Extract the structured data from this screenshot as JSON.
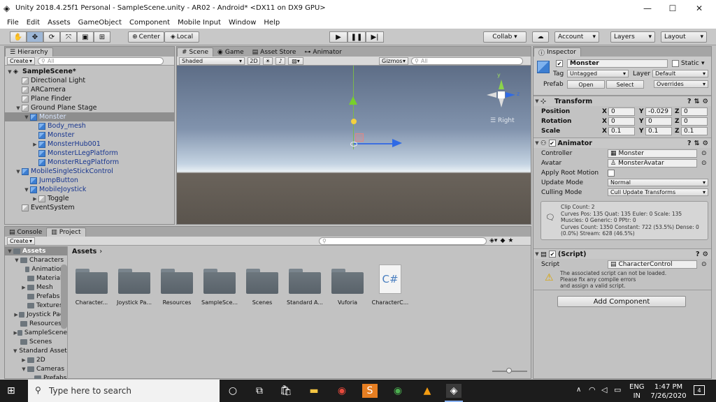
{
  "window": {
    "title": "Unity 2018.4.25f1 Personal - SampleScene.unity - AR02 - Android* <DX11 on DX9 GPU>",
    "minimize": "—",
    "maximize": "☐",
    "close": "✕"
  },
  "menu": [
    "File",
    "Edit",
    "Assets",
    "GameObject",
    "Component",
    "Mobile Input",
    "Window",
    "Help"
  ],
  "toolbar": {
    "center": "Center",
    "local": "Local",
    "collab": "Collab ▾",
    "account": "Account",
    "layers": "Layers",
    "layout": "Layout"
  },
  "hierarchy": {
    "tab": "Hierarchy",
    "create": "Create",
    "search_placeholder": "All",
    "rows": [
      {
        "label": "SampleScene*",
        "indent": 0,
        "icon": "unity",
        "arrow": "▼",
        "bold": true
      },
      {
        "label": "Directional Light",
        "indent": 1,
        "icon": "g",
        "arrow": ""
      },
      {
        "label": "ARCamera",
        "indent": 1,
        "icon": "g",
        "arrow": ""
      },
      {
        "label": "Plane Finder",
        "indent": 1,
        "icon": "g",
        "arrow": ""
      },
      {
        "label": "Ground Plane Stage",
        "indent": 1,
        "icon": "g",
        "arrow": "▼"
      },
      {
        "label": "Monster",
        "indent": 2,
        "icon": "b",
        "arrow": "▼",
        "selected": true,
        "blue": true
      },
      {
        "label": "Body_mesh",
        "indent": 3,
        "icon": "b",
        "arrow": "",
        "blue": true
      },
      {
        "label": "Monster",
        "indent": 3,
        "icon": "b",
        "arrow": "",
        "blue": true
      },
      {
        "label": "MonsterHub001",
        "indent": 3,
        "icon": "b",
        "arrow": "▶",
        "blue": true
      },
      {
        "label": "MonsterLLegPlatform",
        "indent": 3,
        "icon": "b",
        "arrow": "",
        "blue": true
      },
      {
        "label": "MonsterRLegPlatform",
        "indent": 3,
        "icon": "b",
        "arrow": "",
        "blue": true
      },
      {
        "label": "MobileSingleStickControl",
        "indent": 1,
        "icon": "b",
        "arrow": "▼",
        "blue": true
      },
      {
        "label": "JumpButton",
        "indent": 2,
        "icon": "b",
        "arrow": "",
        "blue": true
      },
      {
        "label": "MobileJoystick",
        "indent": 2,
        "icon": "b",
        "arrow": "▼",
        "blue": true
      },
      {
        "label": "Toggle",
        "indent": 3,
        "icon": "g",
        "arrow": "▶"
      },
      {
        "label": "EventSystem",
        "indent": 1,
        "icon": "g",
        "arrow": ""
      }
    ]
  },
  "scene": {
    "tabs": [
      "Scene",
      "Game",
      "Asset Store",
      "Animator"
    ],
    "shaded": "Shaded",
    "mode_2d": "2D",
    "gizmos": "Gizmos",
    "search_placeholder": "All",
    "view_label": "Right",
    "axis_y": "y",
    "axis_z": "z"
  },
  "project": {
    "tabs": [
      "Console",
      "Project"
    ],
    "create": "Create",
    "breadcrumb": "Assets",
    "tree": [
      {
        "label": "Assets",
        "indent": 0,
        "arrow": "▼",
        "selected": true,
        "bold": true
      },
      {
        "label": "Characters",
        "indent": 1,
        "arrow": "▼"
      },
      {
        "label": "Animations",
        "indent": 2,
        "arrow": ""
      },
      {
        "label": "Materials",
        "indent": 2,
        "arrow": ""
      },
      {
        "label": "Mesh",
        "indent": 2,
        "arrow": "▶"
      },
      {
        "label": "Prefabs",
        "indent": 2,
        "arrow": ""
      },
      {
        "label": "Textures",
        "indent": 2,
        "arrow": ""
      },
      {
        "label": "Joystick Pack",
        "indent": 1,
        "arrow": "▶"
      },
      {
        "label": "Resources",
        "indent": 1,
        "arrow": ""
      },
      {
        "label": "SampleScene",
        "indent": 1,
        "arrow": "▶"
      },
      {
        "label": "Scenes",
        "indent": 1,
        "arrow": ""
      },
      {
        "label": "Standard Assets",
        "indent": 1,
        "arrow": "▼"
      },
      {
        "label": "2D",
        "indent": 2,
        "arrow": "▶"
      },
      {
        "label": "Cameras",
        "indent": 2,
        "arrow": "▼"
      },
      {
        "label": "Prefabs",
        "indent": 3,
        "arrow": ""
      }
    ],
    "items": [
      {
        "label": "Character...",
        "type": "folder"
      },
      {
        "label": "Joystick Pa...",
        "type": "folder"
      },
      {
        "label": "Resources",
        "type": "folder"
      },
      {
        "label": "SampleSce...",
        "type": "folder"
      },
      {
        "label": "Scenes",
        "type": "folder"
      },
      {
        "label": "Standard A...",
        "type": "folder"
      },
      {
        "label": "Vuforia",
        "type": "folder"
      },
      {
        "label": "CharacterC...",
        "type": "script",
        "glyph": "C#"
      }
    ]
  },
  "inspector": {
    "tab": "Inspector",
    "name": "Monster",
    "static": "Static",
    "tag_label": "Tag",
    "tag": "Untagged",
    "layer_label": "Layer",
    "layer": "Default",
    "prefab_label": "Prefab",
    "open": "Open",
    "select": "Select",
    "overrides": "Overrides",
    "transform": {
      "title": "Transform",
      "rows": [
        {
          "label": "Position",
          "x": "0",
          "y": "-0.029",
          "z": "0"
        },
        {
          "label": "Rotation",
          "x": "0",
          "y": "0",
          "z": "0"
        },
        {
          "label": "Scale",
          "x": "0.1",
          "y": "0.1",
          "z": "0.1"
        }
      ]
    },
    "animator": {
      "title": "Animator",
      "controller_label": "Controller",
      "controller": "Monster",
      "avatar_label": "Avatar",
      "avatar": "MonsterAvatar",
      "root_motion_label": "Apply Root Motion",
      "update_mode_label": "Update Mode",
      "update_mode": "Normal",
      "culling_label": "Culling Mode",
      "culling": "Cull Update Transforms",
      "info": [
        "Clip Count: 2",
        "Curves Pos: 135 Quat: 135 Euler: 0 Scale: 135",
        "Muscles: 0 Generic: 0 PPtr: 0",
        "Curves Count: 1350 Constant: 722 (53.5%) Dense: 0",
        "(0.0%) Stream: 628 (46.5%)"
      ]
    },
    "script": {
      "title": "(Script)",
      "label": "Script",
      "value": "CharacterControl",
      "warning": [
        "The associated script can not be loaded.",
        "Please fix any compile errors",
        "and assign a valid script."
      ]
    },
    "add_component": "Add Component"
  },
  "taskbar": {
    "search_placeholder": "Type here to search",
    "lang": "ENG",
    "region": "IN",
    "time": "1:47 PM",
    "date": "7/26/2020",
    "notifications": "4"
  }
}
